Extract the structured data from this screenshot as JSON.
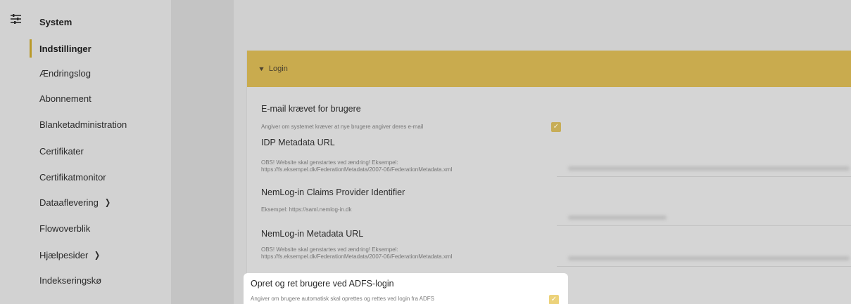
{
  "sidebar": {
    "section_title": "System",
    "items": [
      {
        "label": "Indstillinger",
        "active": true,
        "has_children": false
      },
      {
        "label": "Ændringslog",
        "active": false,
        "has_children": false
      },
      {
        "label": "Abonnement",
        "active": false,
        "has_children": false
      },
      {
        "label": "Blanketadministration",
        "active": false,
        "has_children": false
      },
      {
        "label": "Certifikater",
        "active": false,
        "has_children": false
      },
      {
        "label": "Certifikatmonitor",
        "active": false,
        "has_children": false
      },
      {
        "label": "Dataaflevering",
        "active": false,
        "has_children": true
      },
      {
        "label": "Flowoverblik",
        "active": false,
        "has_children": false
      },
      {
        "label": "Hjælpesider",
        "active": false,
        "has_children": true
      },
      {
        "label": "Indekseringskø",
        "active": false,
        "has_children": false
      }
    ],
    "icons": {
      "section": "sliders-icon",
      "expand": "chevron-right-icon"
    }
  },
  "panel": {
    "header": "Login",
    "header_color": "#c9ab4e",
    "settings": [
      {
        "title": "E-mail krævet for brugere",
        "description": [
          "Angiver om systemet kræver at nye brugere angiver deres e-mail"
        ],
        "control": "checkbox",
        "checked": true
      },
      {
        "title": "IDP Metadata URL",
        "description": [
          "OBS! Website skal genstartes ved ændring! Eksempel:",
          "https://fs.eksempel.dk/FederationMetadata/2007-06/FederationMetadata.xml"
        ],
        "control": "text"
      },
      {
        "title": "NemLog-in Claims Provider Identifier",
        "description": [
          "Eksempel: https://saml.nemlog-in.dk"
        ],
        "control": "text"
      },
      {
        "title": "NemLog-in Metadata URL",
        "description": [
          "OBS! Website skal genstartes ved ændring! Eksempel:",
          "https://fs.eksempel.dk/FederationMetadata/2007-06/FederationMetadata.xml"
        ],
        "control": "text"
      },
      {
        "title": "Opret og ret brugere ved ADFS-login",
        "description": [
          "Angiver om brugere automatisk skal oprettes og rettes ved login fra ADFS"
        ],
        "control": "checkbox",
        "checked": true,
        "highlighted": true
      }
    ]
  },
  "colors": {
    "accent": "#c9ab4e",
    "active_indicator": "#b99a2a",
    "checkbox": "#c7ad57"
  },
  "glyphs": {
    "check": "✓",
    "caret_down": "▼",
    "chevron_right": "❯"
  }
}
